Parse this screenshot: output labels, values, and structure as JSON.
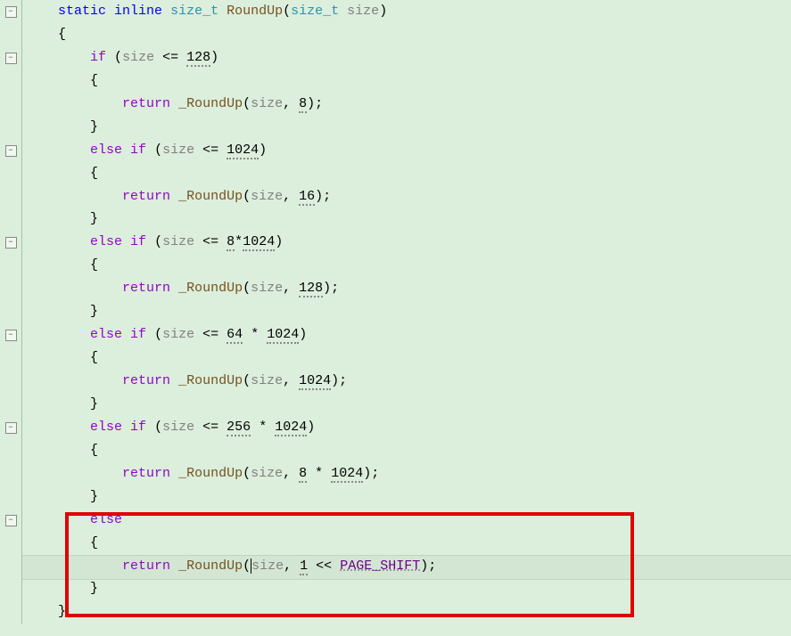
{
  "code": {
    "line1_static": "static",
    "line1_inline": "inline",
    "line1_type1": "size_t",
    "line1_func": "RoundUp",
    "line1_type2": "size_t",
    "line1_param": "size",
    "brace_open": "{",
    "brace_close": "}",
    "if": "if",
    "else": "else",
    "return": "return",
    "size": "size",
    "roundup_call": "_RoundUp",
    "op_le": "<=",
    "op_shl": "<<",
    "op_mul": "*",
    "comma": ",",
    "semi": ";",
    "paren_o": "(",
    "paren_c": ")",
    "num_128": "128",
    "num_8": "8",
    "num_1024": "1024",
    "num_16": "16",
    "num_8x1024": "8",
    "num_64": "64",
    "num_256": "256",
    "num_1": "1",
    "page_shift": "PAGE_SHIFT"
  }
}
